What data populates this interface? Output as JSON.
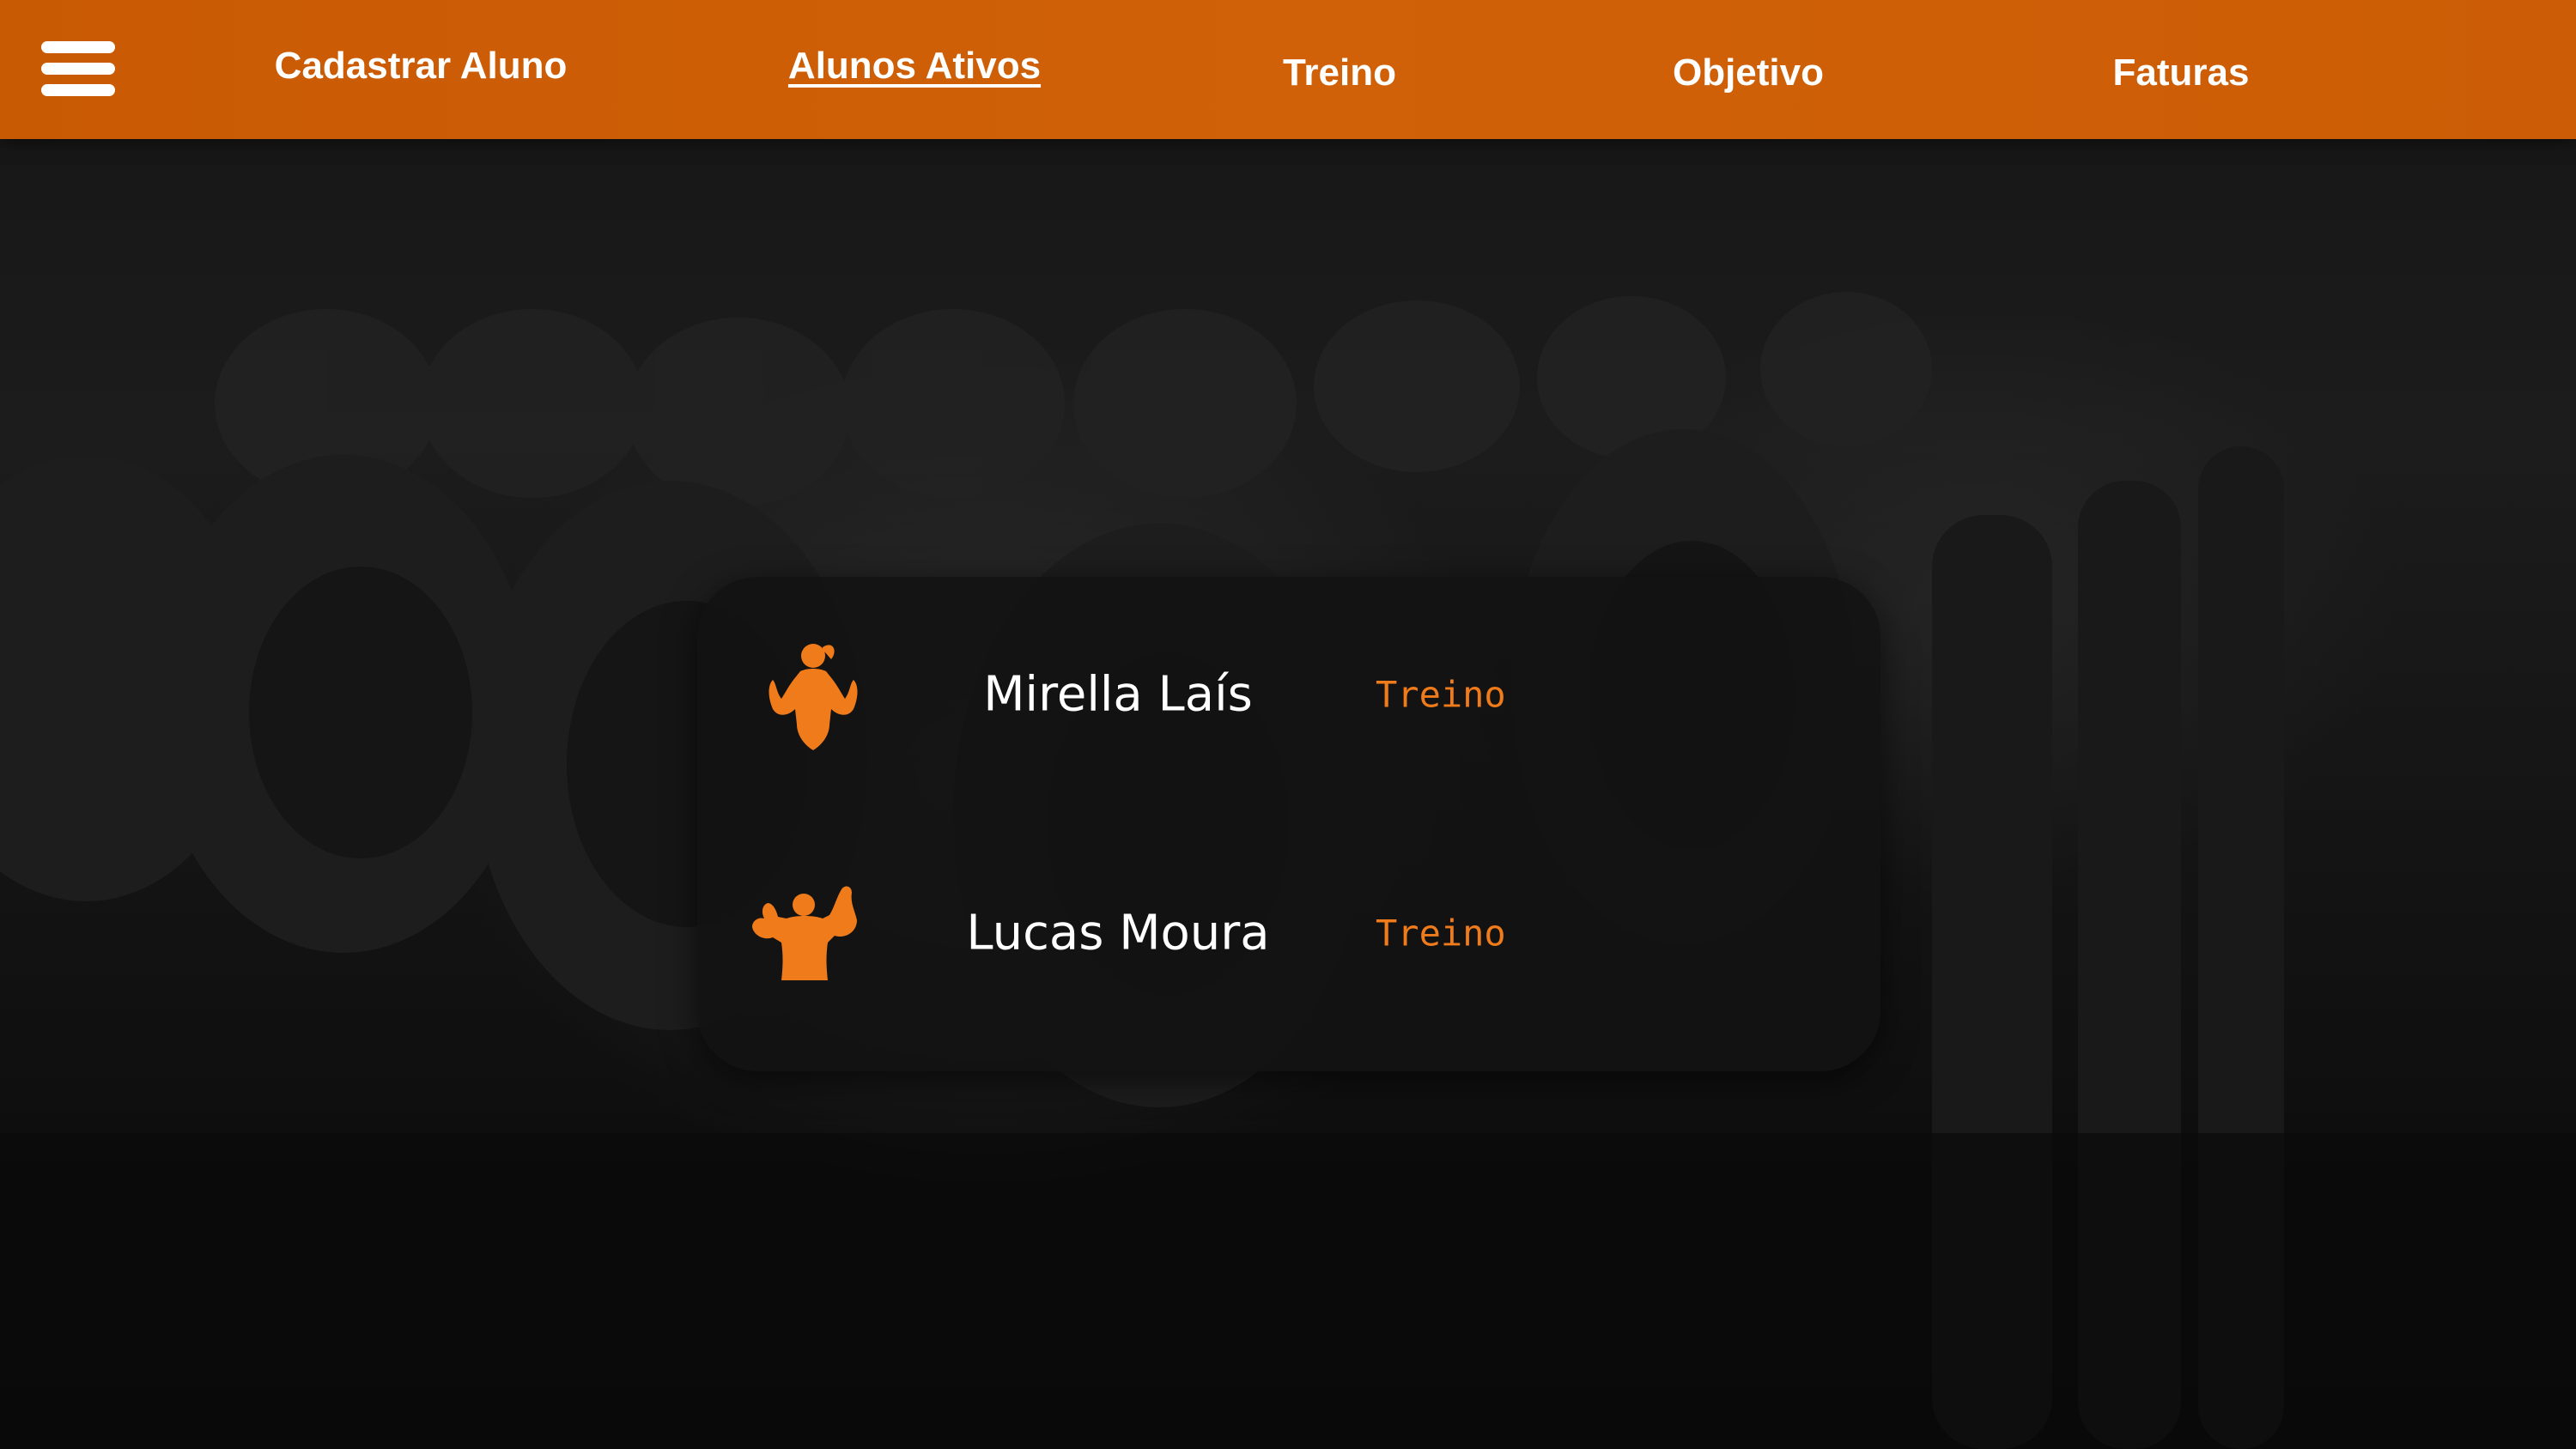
{
  "nav": {
    "menu_icon": "hamburger-menu-icon",
    "items": [
      {
        "label": "Cadastrar Aluno",
        "active": false
      },
      {
        "label": "Alunos Ativos",
        "active": true
      },
      {
        "label": "Treino",
        "active": false
      },
      {
        "label": "Objetivo",
        "active": false
      },
      {
        "label": "Faturas",
        "active": false
      }
    ]
  },
  "students": [
    {
      "name": "Mirella Laís",
      "icon": "female-bodybuilder-icon",
      "action_label": "Treino"
    },
    {
      "name": "Lucas Moura",
      "icon": "male-bodybuilder-icon",
      "action_label": "Treino"
    }
  ],
  "colors": {
    "brand_orange": "#cc5d06",
    "accent_orange": "#f07b1a",
    "card_bg": "#121212",
    "text_light": "#ffffff"
  }
}
